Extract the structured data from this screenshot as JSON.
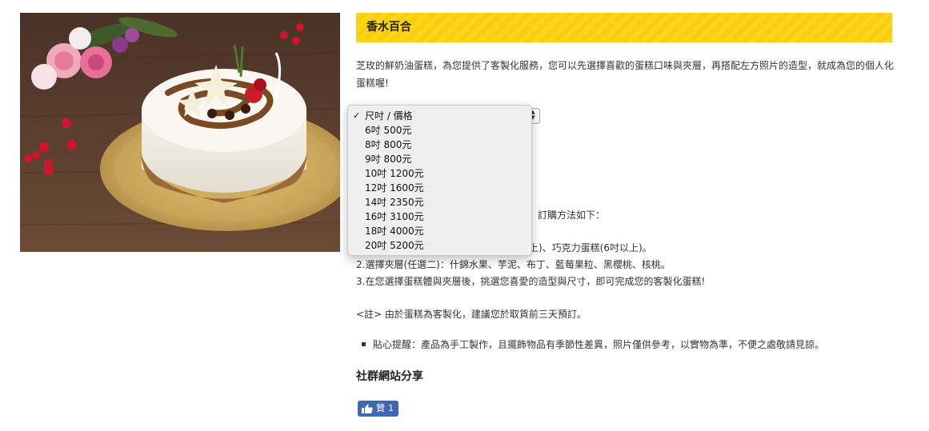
{
  "product": {
    "title": "香水百合",
    "image_alt": "cake-photo",
    "description_line1": "芝玫的鮮奶油蛋糕，為您提供了客製化服務，您可以先選擇喜歡的蛋糕口味與夾層，再搭配左方照片的造型，就成為您的個人化",
    "description_line2": "蛋糕喔!"
  },
  "size_select": {
    "selected": "尺吋 / 價格",
    "options": [
      "尺吋 / 價格",
      "6吋 500元",
      "8吋 800元",
      "9吋 800元",
      "10吋 1200元",
      "12吋 1600元",
      "14吋 2350元",
      "16吋 3100元",
      "18吋 4000元",
      "20吋 5200元"
    ]
  },
  "order_info": {
    "intro_tail": "務，訂購方法如下：",
    "step1_tail": "以上)、巧克力蛋糕(6吋以上)。",
    "step2": "2.選擇夾層(任選二)：什錦水果、芋泥、布丁、藍莓果粒、黑櫻桃、核桃。",
    "step3": "3.在您選擇蛋糕體與夾層後，挑選您喜愛的造型與尺寸，即可完成您的客製化蛋糕!",
    "note": "<註> 由於蛋糕為客製化，建議您於取貨前三天預訂。",
    "reminder": "貼心提醒：產品為手工製作，且擺飾物品有季節性差異，照片僅供參考，以實物為準，不便之處敬請見諒。"
  },
  "share": {
    "heading": "社群網站分享",
    "like_label": "贊",
    "like_count": "1"
  },
  "colors": {
    "title_bar": "#fcd41a",
    "fb_blue": "#4267b2"
  }
}
